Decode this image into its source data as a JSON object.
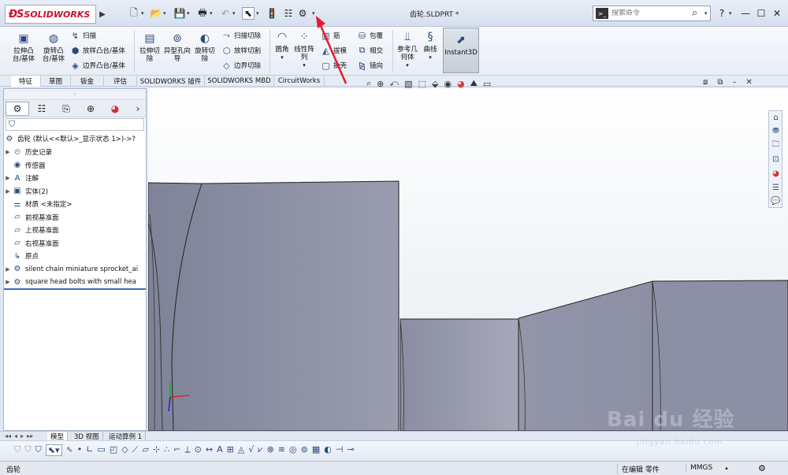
{
  "app": {
    "brand": "SOLIDWORKS",
    "document_title": "齿轮.SLDPRT *",
    "search": {
      "placeholder": "搜索命令"
    }
  },
  "ribbon": {
    "features": [
      {
        "label": "拉伸凸台/基体",
        "icon": "extrude-boss-icon"
      },
      {
        "label": "旋转凸台/基体",
        "icon": "revolve-boss-icon"
      }
    ],
    "small_features": [
      {
        "label": "扫描",
        "icon": "sweep-icon"
      },
      {
        "label": "放样凸台/基体",
        "icon": "loft-icon"
      },
      {
        "label": "边界凸台/基体",
        "icon": "boundary-boss-icon"
      }
    ],
    "cuts": [
      {
        "label": "拉伸切除",
        "icon": "extrude-cut-icon"
      },
      {
        "label": "异型孔向导",
        "icon": "hole-wizard-icon"
      },
      {
        "label": "旋转切除",
        "icon": "revolve-cut-icon"
      }
    ],
    "small_cuts": [
      {
        "label": "扫描切除",
        "icon": "swept-cut-icon"
      },
      {
        "label": "放样切割",
        "icon": "lofted-cut-icon"
      },
      {
        "label": "边界切除",
        "icon": "boundary-cut-icon"
      }
    ],
    "fillet": "圆角",
    "pattern": "线性阵列",
    "col3": [
      "筋",
      "拔模",
      "抽壳"
    ],
    "col4": [
      "包覆",
      "相交",
      "镜向"
    ],
    "refgeom": "参考几何体",
    "curves": "曲线",
    "instant3d": "Instant3D"
  },
  "command_tabs": [
    "特征",
    "草图",
    "钣金",
    "评估",
    "SOLIDWORKS 插件",
    "SOLIDWORKS MBD",
    "CircuitWorks"
  ],
  "tree": {
    "root": "齿轮  (默认<<默认>_显示状态 1>)->?",
    "items": [
      {
        "label": "历史记录",
        "icon": "history-icon",
        "expandable": true
      },
      {
        "label": "传感器",
        "icon": "sensor-icon",
        "expandable": false
      },
      {
        "label": "注解",
        "icon": "annotation-icon",
        "expandable": true
      },
      {
        "label": "实体(2)",
        "icon": "solid-bodies-icon",
        "expandable": true
      },
      {
        "label": "材质 <未指定>",
        "icon": "material-icon",
        "expandable": false
      },
      {
        "label": "前视基准面",
        "icon": "plane-icon",
        "expandable": false
      },
      {
        "label": "上视基准面",
        "icon": "plane-icon",
        "expandable": false
      },
      {
        "label": "右视基准面",
        "icon": "plane-icon",
        "expandable": false
      },
      {
        "label": "原点",
        "icon": "origin-icon",
        "expandable": false
      },
      {
        "label": "silent chain miniature sprocket_ai",
        "icon": "part-icon",
        "expandable": true
      },
      {
        "label": "square head bolts with small hea",
        "icon": "part-icon",
        "expandable": true
      }
    ]
  },
  "bottom_tabs": [
    "模型",
    "3D 视图",
    "运动算例 1"
  ],
  "status": {
    "name": "齿轮",
    "mode": "在编辑 零件",
    "units": "MMGS"
  },
  "watermark": {
    "text": "Bai du 经验",
    "url": "jingyan.baidu.com"
  },
  "colors": {
    "accent": "#c8102e",
    "annotation_arrow": "#e8192c",
    "model_face": "#8e92a8"
  }
}
